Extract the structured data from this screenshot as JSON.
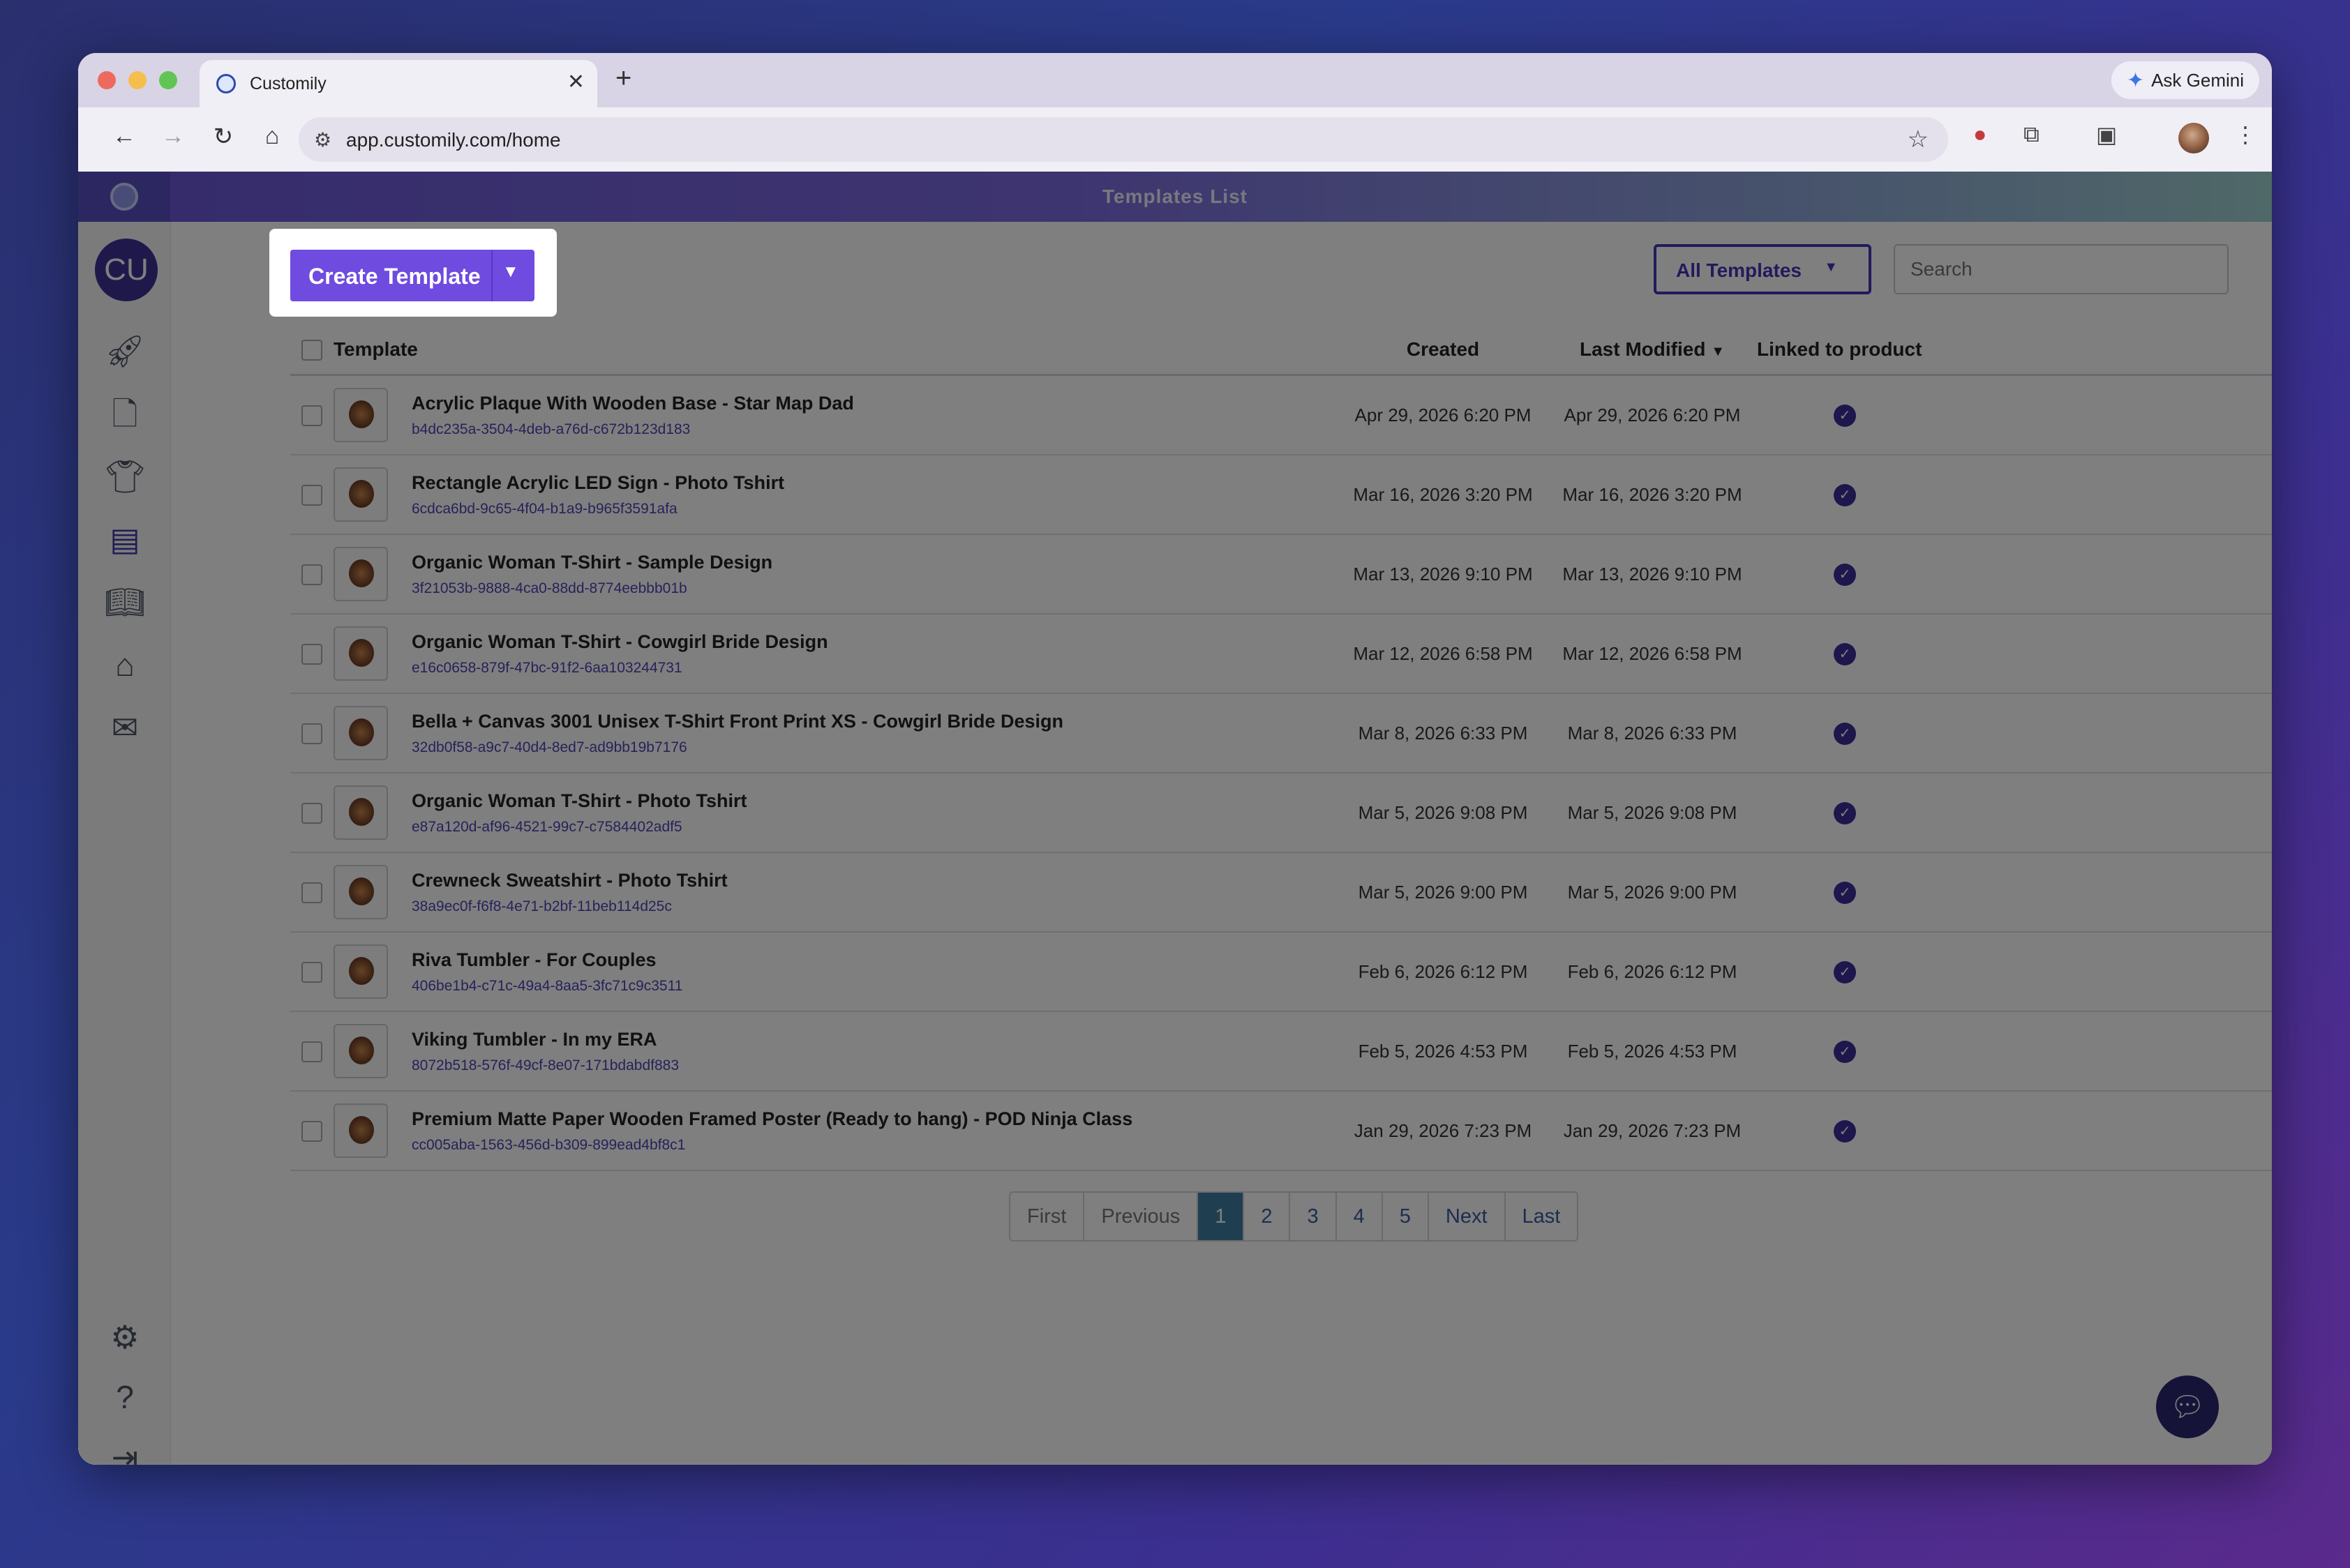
{
  "browser": {
    "tab_title": "Customily",
    "new_tab": "+",
    "close_tab": "✕",
    "url": "app.customily.com/home",
    "ask_gemini": "Ask Gemini"
  },
  "app": {
    "header_title": "Templates List",
    "avatar_initials": "CU",
    "create_button": "Create Template",
    "filter_dropdown": "All Templates",
    "search_placeholder": "Search",
    "columns": {
      "template": "Template",
      "created": "Created",
      "last_modified": "Last Modified",
      "linked": "Linked to product"
    },
    "rows": [
      {
        "name": "Acrylic Plaque With Wooden Base - Star Map Dad",
        "id": "b4dc235a-3504-4deb-a76d-c672b123d183",
        "created": "Apr 29, 2026 6:20 PM",
        "modified": "Apr 29, 2026 6:20 PM"
      },
      {
        "name": "Rectangle Acrylic LED Sign - Photo Tshirt",
        "id": "6cdca6bd-9c65-4f04-b1a9-b965f3591afa",
        "created": "Mar 16, 2026 3:20 PM",
        "modified": "Mar 16, 2026 3:20 PM"
      },
      {
        "name": "Organic Woman T-Shirt - Sample Design",
        "id": "3f21053b-9888-4ca0-88dd-8774eebbb01b",
        "created": "Mar 13, 2026 9:10 PM",
        "modified": "Mar 13, 2026 9:10 PM"
      },
      {
        "name": "Organic Woman T-Shirt - Cowgirl Bride Design",
        "id": "e16c0658-879f-47bc-91f2-6aa103244731",
        "created": "Mar 12, 2026 6:58 PM",
        "modified": "Mar 12, 2026 6:58 PM"
      },
      {
        "name": "Bella + Canvas 3001 Unisex T-Shirt Front Print XS - Cowgirl Bride Design",
        "id": "32db0f58-a9c7-40d4-8ed7-ad9bb19b7176",
        "created": "Mar 8, 2026 6:33 PM",
        "modified": "Mar 8, 2026 6:33 PM"
      },
      {
        "name": "Organic Woman T-Shirt - Photo Tshirt",
        "id": "e87a120d-af96-4521-99c7-c7584402adf5",
        "created": "Mar 5, 2026 9:08 PM",
        "modified": "Mar 5, 2026 9:08 PM"
      },
      {
        "name": "Crewneck Sweatshirt - Photo Tshirt",
        "id": "38a9ec0f-f6f8-4e71-b2bf-11beb114d25c",
        "created": "Mar 5, 2026 9:00 PM",
        "modified": "Mar 5, 2026 9:00 PM"
      },
      {
        "name": "Riva Tumbler - For Couples",
        "id": "406be1b4-c71c-49a4-8aa5-3fc71c9c3511",
        "created": "Feb 6, 2026 6:12 PM",
        "modified": "Feb 6, 2026 6:12 PM"
      },
      {
        "name": "Viking Tumbler - In my ERA",
        "id": "8072b518-576f-49cf-8e07-171bdabdf883",
        "created": "Feb 5, 2026 4:53 PM",
        "modified": "Feb 5, 2026 4:53 PM"
      },
      {
        "name": "Premium Matte Paper Wooden Framed Poster (Ready to hang) - POD Ninja Class",
        "id": "cc005aba-1563-456d-b309-899ead4bf8c1",
        "created": "Jan 29, 2026 7:23 PM",
        "modified": "Jan 29, 2026 7:23 PM"
      }
    ],
    "pagination": {
      "first": "First",
      "previous": "Previous",
      "pages": [
        "1",
        "2",
        "3",
        "4",
        "5"
      ],
      "current": "1",
      "next": "Next",
      "last": "Last"
    }
  },
  "colors": {
    "accent": "#6f4be0",
    "header_start": "#6b57d8",
    "header_end": "#9fd1d0",
    "link": "#4d44b5"
  }
}
